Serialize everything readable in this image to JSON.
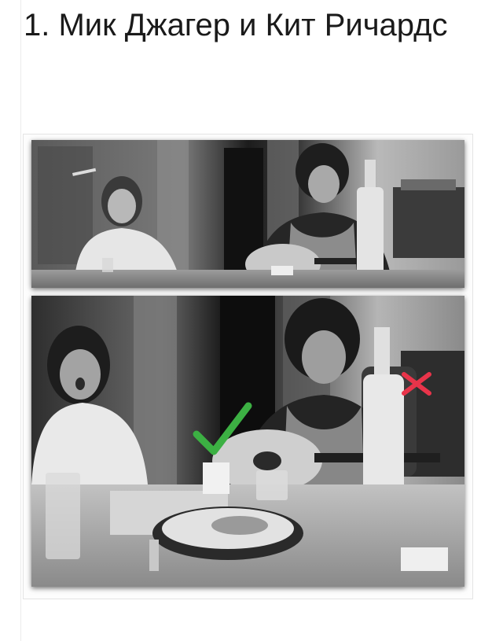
{
  "article": {
    "heading": "1. Мик Джагер и Кит Ричардс"
  },
  "images": {
    "top_photo": "black-and-white-photo",
    "bottom_photo": "black-and-white-photo"
  },
  "marks": {
    "check": {
      "icon": "check-icon",
      "color": "#3cb043"
    },
    "cross": {
      "icon": "cross-icon",
      "color": "#e8344a"
    }
  }
}
